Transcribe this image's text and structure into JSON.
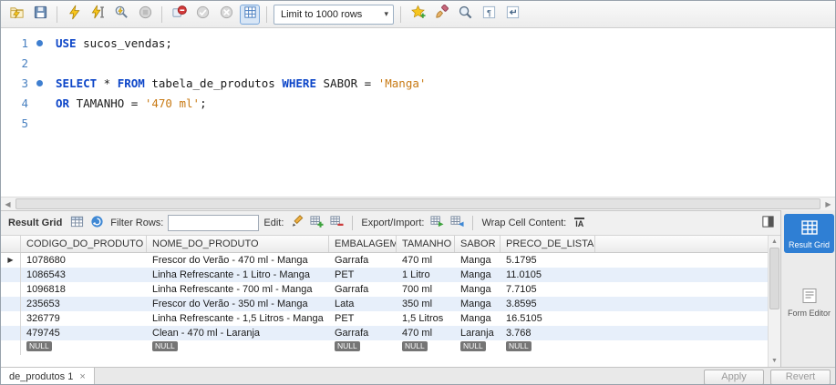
{
  "toolbar": {
    "limit_dropdown": {
      "value": "Limit to 1000 rows"
    },
    "icons": [
      "open-script",
      "save-script",
      "execute",
      "execute-current-statement",
      "explain-plan",
      "stop-execution",
      "toggle-stop-on-error",
      "commit",
      "rollback",
      "toggle-autocommit",
      "save-snippet",
      "beautify",
      "find",
      "show-invisible-characters",
      "wrap-text"
    ]
  },
  "editor": {
    "lines": [
      {
        "number": "1",
        "marker": true,
        "segments": [
          {
            "text": "USE",
            "type": "kw"
          },
          {
            "text": " sucos_vendas;",
            "type": "plain"
          }
        ]
      },
      {
        "number": "2",
        "marker": false,
        "segments": []
      },
      {
        "number": "3",
        "marker": true,
        "segments": [
          {
            "text": "SELECT",
            "type": "kw"
          },
          {
            "text": " * ",
            "type": "plain"
          },
          {
            "text": "FROM",
            "type": "kw"
          },
          {
            "text": " tabela_de_produtos ",
            "type": "plain"
          },
          {
            "text": "WHERE",
            "type": "kw"
          },
          {
            "text": " SABOR = ",
            "type": "plain"
          },
          {
            "text": "'Manga'",
            "type": "str"
          }
        ]
      },
      {
        "number": "4",
        "marker": false,
        "segments": [
          {
            "text": "OR",
            "type": "kw"
          },
          {
            "text": " TAMANHO = ",
            "type": "plain"
          },
          {
            "text": "'470 ml'",
            "type": "str"
          },
          {
            "text": ";",
            "type": "plain"
          }
        ]
      },
      {
        "number": "5",
        "marker": false,
        "segments": []
      }
    ]
  },
  "result_toolbar": {
    "title": "Result Grid",
    "filter_label": "Filter Rows:",
    "filter_value": "",
    "edit_label": "Edit:",
    "export_label": "Export/Import:",
    "wrap_label": "Wrap Cell Content:",
    "wrap_icon_text": "IA"
  },
  "grid": {
    "columns": [
      "CODIGO_DO_PRODUTO",
      "NOME_DO_PRODUTO",
      "EMBALAGEM",
      "TAMANHO",
      "SABOR",
      "PRECO_DE_LISTA"
    ],
    "rows": [
      [
        "1078680",
        "Frescor do Verão - 470 ml - Manga",
        "Garrafa",
        "470 ml",
        "Manga",
        "5.1795"
      ],
      [
        "1086543",
        "Linha Refrescante - 1 Litro - Manga",
        "PET",
        "1 Litro",
        "Manga",
        "11.0105"
      ],
      [
        "1096818",
        "Linha Refrescante - 700 ml - Manga",
        "Garrafa",
        "700 ml",
        "Manga",
        "7.7105"
      ],
      [
        "235653",
        "Frescor do Verão - 350 ml - Manga",
        "Lata",
        "350 ml",
        "Manga",
        "3.8595"
      ],
      [
        "326779",
        "Linha Refrescante - 1,5 Litros - Manga",
        "PET",
        "1,5 Litros",
        "Manga",
        "16.5105"
      ],
      [
        "479745",
        "Clean - 470 ml - Laranja",
        "Garrafa",
        "470 ml",
        "Laranja",
        "3.768"
      ]
    ],
    "null_placeholder": "NULL"
  },
  "sidebar": {
    "items": [
      {
        "label": "Result Grid",
        "active": true
      },
      {
        "label": "Form Editor",
        "active": false
      }
    ]
  },
  "bottom": {
    "tab_label": "de_produtos 1",
    "apply_label": "Apply",
    "revert_label": "Revert"
  }
}
